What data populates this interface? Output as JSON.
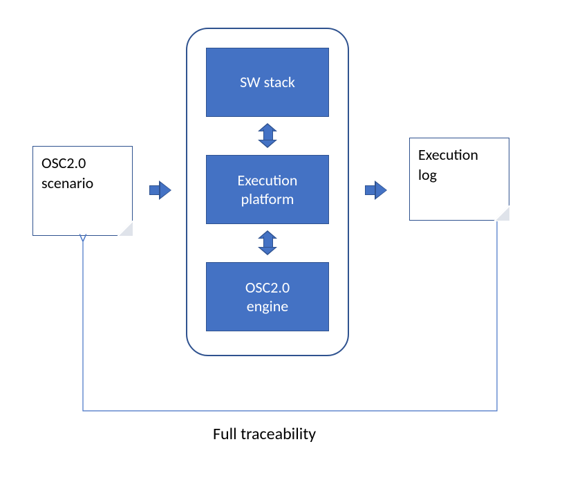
{
  "left_doc": {
    "line1": "OSC2.0",
    "line2": "scenario"
  },
  "right_doc": {
    "line1": "Execution",
    "line2": "log"
  },
  "center": {
    "box1": "SW stack",
    "box2_line1": "Execution",
    "box2_line2": "platform",
    "box3_line1": "OSC2.0",
    "box3_line2": "engine"
  },
  "trace_label": "Full traceability",
  "colors": {
    "accent": "#4472c4",
    "border": "#2f528f"
  }
}
